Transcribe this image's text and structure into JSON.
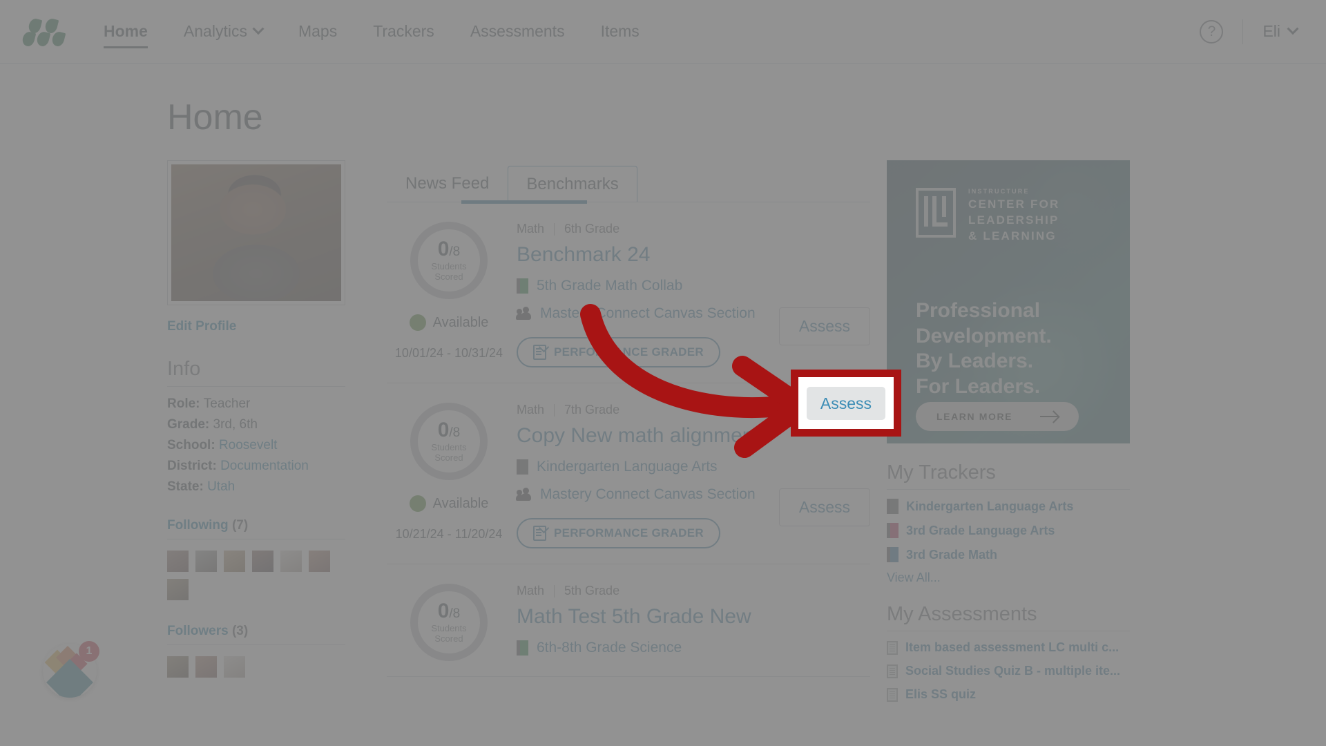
{
  "nav": {
    "logo_icon": "mastery-connect-leaf-logo",
    "items": [
      {
        "label": "Home",
        "active": true,
        "has_caret": false
      },
      {
        "label": "Analytics",
        "active": false,
        "has_caret": true
      },
      {
        "label": "Maps",
        "active": false,
        "has_caret": false
      },
      {
        "label": "Trackers",
        "active": false,
        "has_caret": false
      },
      {
        "label": "Assessments",
        "active": false,
        "has_caret": false
      },
      {
        "label": "Items",
        "active": false,
        "has_caret": false
      }
    ],
    "help_icon": "question-circle-icon",
    "user_name": "Eli",
    "user_caret_icon": "chevron-down-icon"
  },
  "page": {
    "title": "Home"
  },
  "profile": {
    "avatar_alt": "profile-photo",
    "edit_profile": "Edit Profile",
    "info_heading": "Info",
    "info": [
      {
        "label": "Role:",
        "value": "Teacher",
        "is_link": false
      },
      {
        "label": "Grade:",
        "value": "3rd, 6th",
        "is_link": false
      },
      {
        "label": "School:",
        "value": "Roosevelt",
        "is_link": true
      },
      {
        "label": "District:",
        "value": "Documentation",
        "is_link": true
      },
      {
        "label": "State:",
        "value": "Utah",
        "is_link": true
      }
    ],
    "following_label": "Following",
    "following_count": "(7)",
    "following_thumbs": 7,
    "followers_label": "Followers",
    "followers_count": "(3)",
    "followers_thumbs": 3
  },
  "tabs": [
    {
      "label": "News Feed",
      "active": false
    },
    {
      "label": "Benchmarks",
      "active": true
    }
  ],
  "benchmarks": [
    {
      "score": "0",
      "score_denominator": "/8",
      "score_sub_line1": "Students",
      "score_sub_line2": "Scored",
      "status": "Available",
      "status_color": "#3a7a1a",
      "date_range": "10/01/24 - 10/31/24",
      "subject": "Math",
      "grade": "6th Grade",
      "title": "Benchmark 24",
      "tracker": "5th Grade Math Collab",
      "tracker_color": "#0a7a2e",
      "section": "Mastery Connect Canvas Section",
      "grader_label": "PERFORMANCE GRADER",
      "assess_label": "Assess",
      "highlighted": true
    },
    {
      "score": "0",
      "score_denominator": "/8",
      "score_sub_line1": "Students",
      "score_sub_line2": "Scored",
      "status": "Available",
      "status_color": "#3a7a1a",
      "date_range": "10/21/24 - 11/20/24",
      "subject": "Math",
      "grade": "7th Grade",
      "title": "Copy New math alignment",
      "tracker": "Kindergarten Language Arts",
      "tracker_color": "#4a4f53",
      "section": "Mastery Connect Canvas Section",
      "grader_label": "PERFORMANCE GRADER",
      "assess_label": "Assess",
      "highlighted": false
    },
    {
      "score": "0",
      "score_denominator": "/8",
      "score_sub_line1": "Students",
      "score_sub_line2": "Scored",
      "subject": "Math",
      "grade": "5th Grade",
      "title": "Math Test 5th Grade New",
      "tracker": "6th-8th Grade Science",
      "tracker_color": "#0a7a2e",
      "highlighted": false
    }
  ],
  "promo": {
    "brand_tiny": "INSTRUCTURE",
    "brand_line1": "CENTER FOR",
    "brand_line2": "LEADERSHIP",
    "brand_line3": "& LEARNING",
    "headline_line1": "Professional",
    "headline_line2": "Development.",
    "headline_line3": "By Leaders.",
    "headline_line4": "For Leaders.",
    "cta": "LEARN MORE",
    "cta_icon": "arrow-right-icon"
  },
  "trackers": {
    "heading": "My Trackers",
    "items": [
      {
        "label": "Kindergarten Language Arts",
        "color": "#4a4f53"
      },
      {
        "label": "3rd Grade Language Arts",
        "color": "#a8123f"
      },
      {
        "label": "3rd Grade Math",
        "color": "#0f5f8f"
      }
    ],
    "view_all": "View All..."
  },
  "assessments": {
    "heading": "My Assessments",
    "items": [
      {
        "label": "Item based assessment LC multi c...",
        "icon": "document-icon"
      },
      {
        "label": "Social Studies Quiz B - multiple ite...",
        "icon": "document-icon"
      },
      {
        "label": "Elis SS quiz",
        "icon": "document-icon"
      }
    ]
  },
  "fab": {
    "icon": "diamond-cluster-icon",
    "badge": "1"
  },
  "annotation": {
    "arrow_color": "#a81414",
    "highlight_color": "#a81414",
    "highlighted_button": "Assess"
  }
}
